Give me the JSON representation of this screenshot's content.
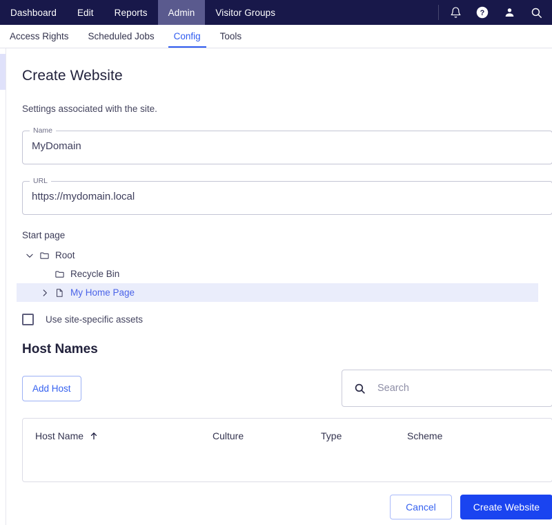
{
  "topnav": {
    "items": [
      {
        "label": "Dashboard",
        "active": false
      },
      {
        "label": "Edit",
        "active": false
      },
      {
        "label": "Reports",
        "active": false
      },
      {
        "label": "Admin",
        "active": true
      },
      {
        "label": "Visitor Groups",
        "active": false
      }
    ],
    "icons": [
      "bell-icon",
      "help-icon",
      "account-icon",
      "search-icon"
    ],
    "background": "#18184a",
    "active_background": "#5a5a8e"
  },
  "subnav": {
    "items": [
      {
        "label": "Access Rights",
        "active": false
      },
      {
        "label": "Scheduled Jobs",
        "active": false
      },
      {
        "label": "Config",
        "active": true
      },
      {
        "label": "Tools",
        "active": false
      }
    ],
    "accent": "#2f5bf0"
  },
  "main": {
    "title": "Create Website",
    "subtitle": "Settings associated with the site.",
    "fields": [
      {
        "label": "Name",
        "value": "MyDomain",
        "placeholder": ""
      },
      {
        "label": "URL",
        "value": "https://mydomain.local",
        "placeholder": ""
      }
    ],
    "start_page": {
      "label": "Start page",
      "nodes": [
        {
          "label": "Root",
          "chevron": "chevron-down-icon",
          "icon": "folder-icon",
          "indent": 0,
          "selected": false
        },
        {
          "label": "Recycle Bin",
          "chevron": "",
          "icon": "folder-icon",
          "indent": 1,
          "selected": false
        },
        {
          "label": "My Home Page",
          "chevron": "chevron-right-icon",
          "icon": "document-icon",
          "indent": 1,
          "selected": true
        }
      ],
      "selected_background": "#eaedfb",
      "selected_color": "#4a63e8"
    },
    "checkbox": {
      "label": "Use site-specific assets",
      "checked": false
    }
  },
  "host_names": {
    "title": "Host Names",
    "add_host_label": "Add Host",
    "search": {
      "placeholder": "Search",
      "value": "",
      "icon": "search-icon"
    },
    "columns": [
      {
        "label": "Host Name",
        "sort": "ascending",
        "sort_icon": "arrow-up-icon"
      },
      {
        "label": "Culture",
        "sort": ""
      },
      {
        "label": "Type",
        "sort": ""
      },
      {
        "label": "Scheme",
        "sort": ""
      }
    ],
    "rows": []
  },
  "footer": {
    "cancel_label": "Cancel",
    "submit_label": "Create Website",
    "primary_color": "#1a44f0"
  }
}
